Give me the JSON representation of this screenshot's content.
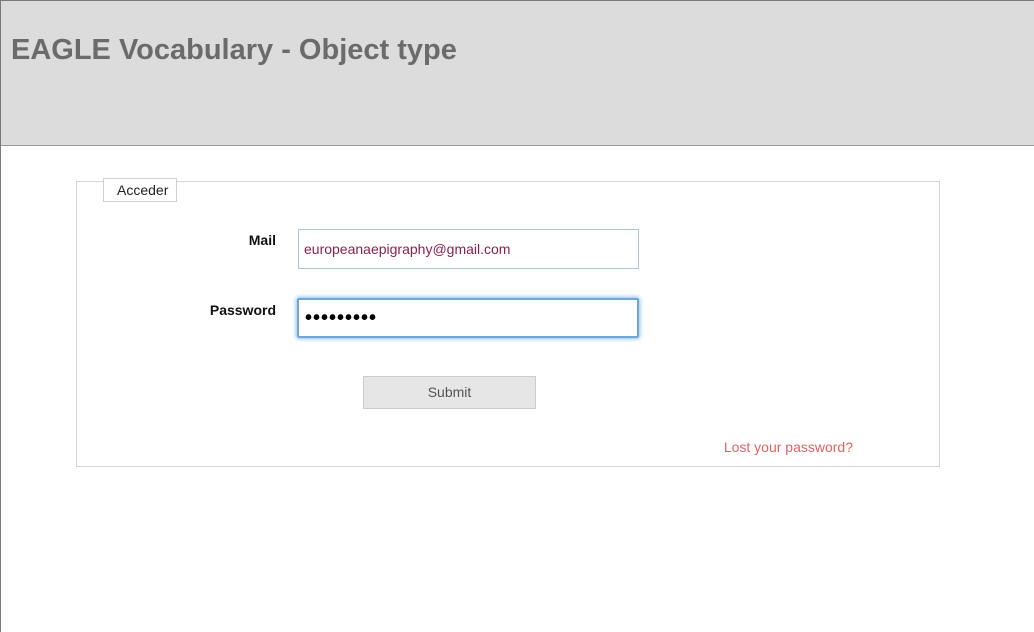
{
  "header": {
    "title": "EAGLE Vocabulary - Object type"
  },
  "login_form": {
    "legend": "Acceder",
    "mail_label": "Mail",
    "mail_value": "europeanaepigraphy@gmail.com",
    "password_label": "Password",
    "password_value": "•••••••••",
    "submit_label": "Submit",
    "lost_password_link": "Lost your password?"
  },
  "colors": {
    "header_bg": "#dcdcdc",
    "header_text": "#6b6b6b",
    "link": "#e06262",
    "mail_text": "#8a2050",
    "focus_ring": "#6fa8d6"
  }
}
